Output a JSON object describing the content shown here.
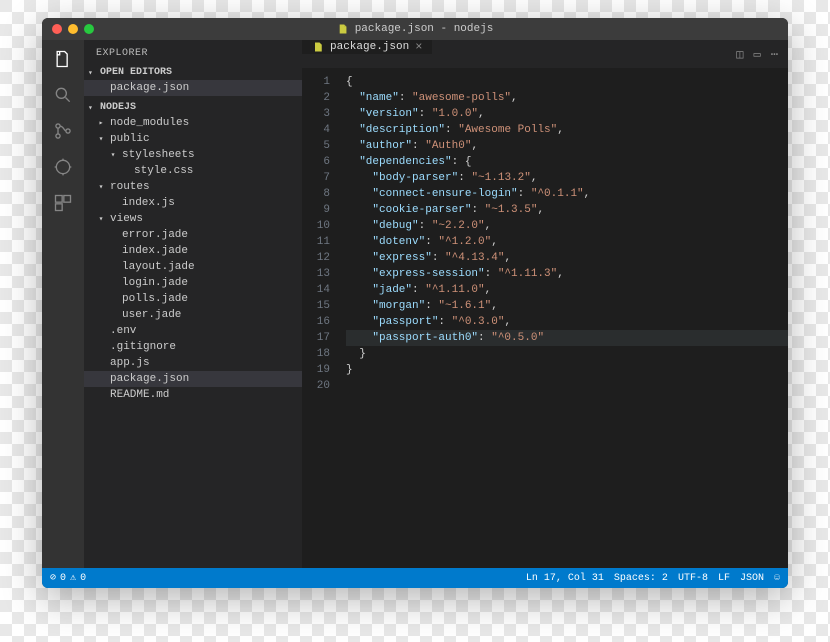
{
  "titlebar": {
    "title": "package.json - nodejs"
  },
  "sidebar": {
    "title": "EXPLORER",
    "sections": {
      "openEditors": {
        "label": "OPEN EDITORS",
        "items": [
          "package.json"
        ]
      },
      "project": {
        "label": "NODEJS",
        "tree": [
          {
            "name": "node_modules",
            "type": "folder",
            "expanded": false,
            "depth": 1
          },
          {
            "name": "public",
            "type": "folder",
            "expanded": true,
            "depth": 1
          },
          {
            "name": "stylesheets",
            "type": "folder",
            "expanded": true,
            "depth": 2
          },
          {
            "name": "style.css",
            "type": "file",
            "depth": 3
          },
          {
            "name": "routes",
            "type": "folder",
            "expanded": true,
            "depth": 1
          },
          {
            "name": "index.js",
            "type": "file",
            "depth": 2
          },
          {
            "name": "views",
            "type": "folder",
            "expanded": true,
            "depth": 1
          },
          {
            "name": "error.jade",
            "type": "file",
            "depth": 2
          },
          {
            "name": "index.jade",
            "type": "file",
            "depth": 2
          },
          {
            "name": "layout.jade",
            "type": "file",
            "depth": 2
          },
          {
            "name": "login.jade",
            "type": "file",
            "depth": 2
          },
          {
            "name": "polls.jade",
            "type": "file",
            "depth": 2
          },
          {
            "name": "user.jade",
            "type": "file",
            "depth": 2
          },
          {
            "name": ".env",
            "type": "file",
            "depth": 1
          },
          {
            "name": ".gitignore",
            "type": "file",
            "depth": 1
          },
          {
            "name": "app.js",
            "type": "file",
            "depth": 1
          },
          {
            "name": "package.json",
            "type": "file",
            "depth": 1,
            "selected": true
          },
          {
            "name": "README.md",
            "type": "file",
            "depth": 1
          }
        ]
      }
    }
  },
  "tabs": [
    {
      "label": "package.json",
      "active": true
    }
  ],
  "editor": {
    "highlightedLine": 17,
    "lines": [
      [
        {
          "t": "punc",
          "v": "{"
        }
      ],
      [
        {
          "t": "indent",
          "v": 2
        },
        {
          "t": "key",
          "v": "\"name\""
        },
        {
          "t": "punc",
          "v": ": "
        },
        {
          "t": "str",
          "v": "\"awesome-polls\""
        },
        {
          "t": "punc",
          "v": ","
        }
      ],
      [
        {
          "t": "indent",
          "v": 2
        },
        {
          "t": "key",
          "v": "\"version\""
        },
        {
          "t": "punc",
          "v": ": "
        },
        {
          "t": "str",
          "v": "\"1.0.0\""
        },
        {
          "t": "punc",
          "v": ","
        }
      ],
      [
        {
          "t": "indent",
          "v": 2
        },
        {
          "t": "key",
          "v": "\"description\""
        },
        {
          "t": "punc",
          "v": ": "
        },
        {
          "t": "str",
          "v": "\"Awesome Polls\""
        },
        {
          "t": "punc",
          "v": ","
        }
      ],
      [
        {
          "t": "indent",
          "v": 2
        },
        {
          "t": "key",
          "v": "\"author\""
        },
        {
          "t": "punc",
          "v": ": "
        },
        {
          "t": "str",
          "v": "\"Auth0\""
        },
        {
          "t": "punc",
          "v": ","
        }
      ],
      [
        {
          "t": "indent",
          "v": 2
        },
        {
          "t": "key",
          "v": "\"dependencies\""
        },
        {
          "t": "punc",
          "v": ": {"
        }
      ],
      [
        {
          "t": "indent",
          "v": 4
        },
        {
          "t": "key",
          "v": "\"body-parser\""
        },
        {
          "t": "punc",
          "v": ": "
        },
        {
          "t": "str",
          "v": "\"~1.13.2\""
        },
        {
          "t": "punc",
          "v": ","
        }
      ],
      [
        {
          "t": "indent",
          "v": 4
        },
        {
          "t": "key",
          "v": "\"connect-ensure-login\""
        },
        {
          "t": "punc",
          "v": ": "
        },
        {
          "t": "str",
          "v": "\"^0.1.1\""
        },
        {
          "t": "punc",
          "v": ","
        }
      ],
      [
        {
          "t": "indent",
          "v": 4
        },
        {
          "t": "key",
          "v": "\"cookie-parser\""
        },
        {
          "t": "punc",
          "v": ": "
        },
        {
          "t": "str",
          "v": "\"~1.3.5\""
        },
        {
          "t": "punc",
          "v": ","
        }
      ],
      [
        {
          "t": "indent",
          "v": 4
        },
        {
          "t": "key",
          "v": "\"debug\""
        },
        {
          "t": "punc",
          "v": ": "
        },
        {
          "t": "str",
          "v": "\"~2.2.0\""
        },
        {
          "t": "punc",
          "v": ","
        }
      ],
      [
        {
          "t": "indent",
          "v": 4
        },
        {
          "t": "key",
          "v": "\"dotenv\""
        },
        {
          "t": "punc",
          "v": ": "
        },
        {
          "t": "str",
          "v": "\"^1.2.0\""
        },
        {
          "t": "punc",
          "v": ","
        }
      ],
      [
        {
          "t": "indent",
          "v": 4
        },
        {
          "t": "key",
          "v": "\"express\""
        },
        {
          "t": "punc",
          "v": ": "
        },
        {
          "t": "str",
          "v": "\"^4.13.4\""
        },
        {
          "t": "punc",
          "v": ","
        }
      ],
      [
        {
          "t": "indent",
          "v": 4
        },
        {
          "t": "key",
          "v": "\"express-session\""
        },
        {
          "t": "punc",
          "v": ": "
        },
        {
          "t": "str",
          "v": "\"^1.11.3\""
        },
        {
          "t": "punc",
          "v": ","
        }
      ],
      [
        {
          "t": "indent",
          "v": 4
        },
        {
          "t": "key",
          "v": "\"jade\""
        },
        {
          "t": "punc",
          "v": ": "
        },
        {
          "t": "str",
          "v": "\"^1.11.0\""
        },
        {
          "t": "punc",
          "v": ","
        }
      ],
      [
        {
          "t": "indent",
          "v": 4
        },
        {
          "t": "key",
          "v": "\"morgan\""
        },
        {
          "t": "punc",
          "v": ": "
        },
        {
          "t": "str",
          "v": "\"~1.6.1\""
        },
        {
          "t": "punc",
          "v": ","
        }
      ],
      [
        {
          "t": "indent",
          "v": 4
        },
        {
          "t": "key",
          "v": "\"passport\""
        },
        {
          "t": "punc",
          "v": ": "
        },
        {
          "t": "str",
          "v": "\"^0.3.0\""
        },
        {
          "t": "punc",
          "v": ","
        }
      ],
      [
        {
          "t": "indent",
          "v": 4
        },
        {
          "t": "key",
          "v": "\"passport-auth0\""
        },
        {
          "t": "punc",
          "v": ": "
        },
        {
          "t": "str",
          "v": "\"^0.5.0\""
        }
      ],
      [
        {
          "t": "indent",
          "v": 2
        },
        {
          "t": "punc",
          "v": "}"
        }
      ],
      [
        {
          "t": "punc",
          "v": "}"
        }
      ],
      []
    ]
  },
  "statusbar": {
    "errors": "0",
    "warnings": "0",
    "cursor": "Ln 17, Col 31",
    "spaces": "Spaces: 2",
    "encoding": "UTF-8",
    "eol": "LF",
    "language": "JSON"
  }
}
